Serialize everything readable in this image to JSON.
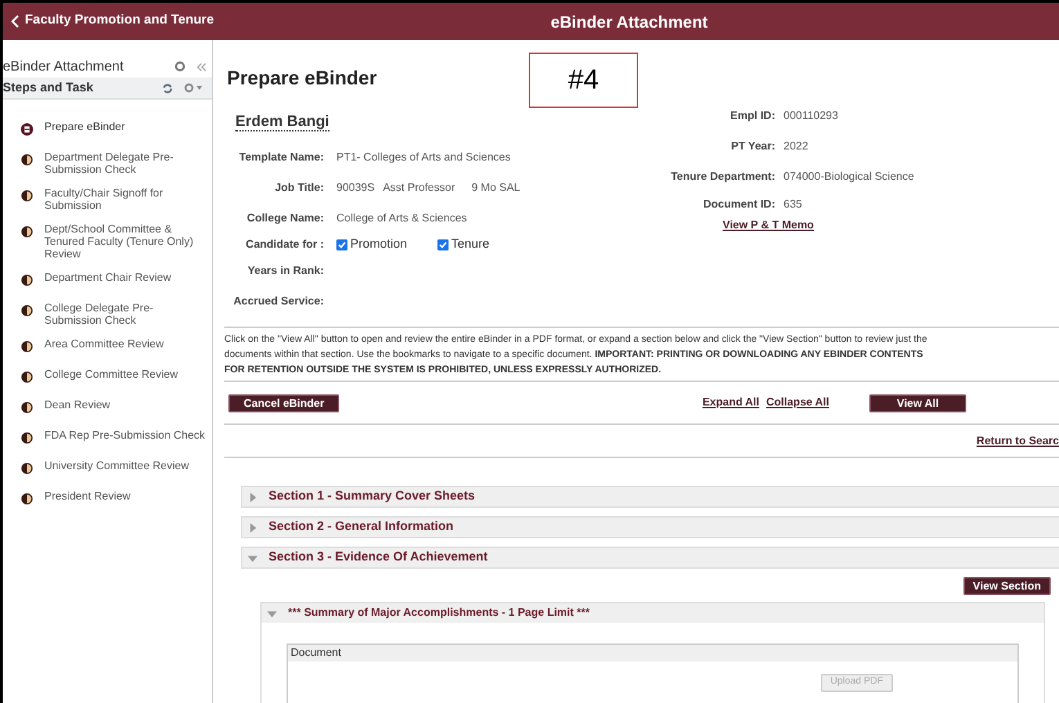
{
  "header": {
    "back_label": "Faculty Promotion and Tenure",
    "title": "eBinder Attachment"
  },
  "sidebar": {
    "title": "eBinder Attachment",
    "panel_title": "Steps and Task",
    "steps": [
      {
        "label": "Prepare eBinder",
        "current": true
      },
      {
        "label": "Department Delegate Pre-Submission Check",
        "current": false
      },
      {
        "label": "Faculty/Chair Signoff for Submission",
        "current": false
      },
      {
        "label": "Dept/School Committee & Tenured Faculty (Tenure Only) Review",
        "current": false
      },
      {
        "label": "Department Chair Review",
        "current": false
      },
      {
        "label": "College Delegate Pre-Submission Check",
        "current": false
      },
      {
        "label": "Area Committee Review",
        "current": false
      },
      {
        "label": "College Committee Review",
        "current": false
      },
      {
        "label": "Dean Review",
        "current": false
      },
      {
        "label": "FDA Rep Pre-Submission Check",
        "current": false
      },
      {
        "label": "University Committee Review",
        "current": false
      },
      {
        "label": "President Review",
        "current": false
      }
    ]
  },
  "annotation": "#4",
  "page_title": "Prepare eBinder",
  "person_name": "Erdem Bangi",
  "left_fields": [
    {
      "label": "Template Name:",
      "kind": "text",
      "value": "PT1- Colleges of Arts and Sciences"
    },
    {
      "label": "Job Title:",
      "kind": "job",
      "parts": [
        "90039S",
        "Asst Professor",
        "9 Mo SAL"
      ]
    },
    {
      "label": "College Name:",
      "kind": "text",
      "value": "College of Arts & Sciences"
    },
    {
      "label": "Candidate for :",
      "kind": "checks",
      "options": [
        {
          "label": "Promotion",
          "checked": true
        },
        {
          "label": "Tenure",
          "checked": true
        }
      ]
    },
    {
      "label": "Years in Rank:",
      "kind": "text"
    },
    {
      "label": "Accrued Service:",
      "kind": "text"
    }
  ],
  "right_fields": [
    {
      "label": "Empl ID:",
      "value": "000110293"
    },
    {
      "label": "PT Year:",
      "value": "2022"
    },
    {
      "label": "Tenure Department:",
      "value": "074000-Biological Science"
    },
    {
      "label": "Document ID:",
      "value": "635"
    }
  ],
  "memo_link": "View P & T Memo",
  "instructions": "Click on the \"View All\" button to open and review the entire eBinder in a PDF format, or expand a section below and click the \"View Section\" button to review just the documents within that section. Use the bookmarks to navigate to a specific document. **IMPORTANT: PRINTING OR DOWNLOADING ANY EBINDER CONTENTS FOR RETENTION OUTSIDE THE SYSTEM IS PROHIBITED, UNLESS EXPRESSLY AUTHORIZED.**",
  "actions": {
    "cancel": "Cancel eBinder",
    "expand_all": "Expand All",
    "collapse_all": "Collapse All",
    "view_all": "View All",
    "return_link": "Return to Searc"
  },
  "sections": [
    {
      "title": "Section 1 - Summary Cover Sheets",
      "expanded": false
    },
    {
      "title": "Section 2 - General Information",
      "expanded": false
    },
    {
      "title": "Section 3 - Evidence Of Achievement",
      "expanded": true,
      "view_button": "View Section",
      "subsection": {
        "title": "*** Summary of Major Accomplishments - 1 Page Limit ***",
        "expanded": true,
        "table_header": "Document",
        "upload_button": "Upload PDF"
      }
    }
  ]
}
